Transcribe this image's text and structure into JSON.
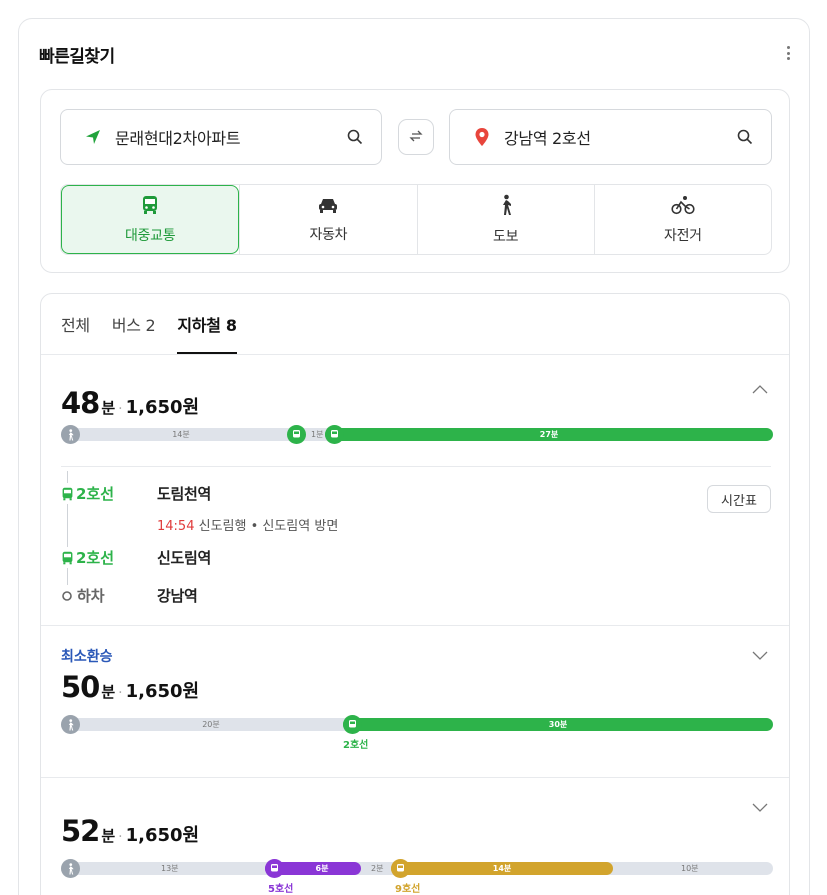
{
  "header": {
    "title": "빠른길찾기"
  },
  "search": {
    "from": "문래현대2차아파트",
    "to": "강남역 2호선"
  },
  "modes": [
    {
      "label": "대중교통",
      "icon": "bus-icon",
      "active": true
    },
    {
      "label": "자동차",
      "icon": "car-icon",
      "active": false
    },
    {
      "label": "도보",
      "icon": "walk-icon",
      "active": false
    },
    {
      "label": "자전거",
      "icon": "bicycle-icon",
      "active": false
    }
  ],
  "tabs": [
    {
      "label": "전체",
      "active": false
    },
    {
      "label": "버스 2",
      "active": false
    },
    {
      "label": "지하철 8",
      "active": true
    }
  ],
  "colors": {
    "line2": "#2db34a",
    "line5": "#8a36d6",
    "line9": "#d2a42d",
    "walk": "#dfe3ea",
    "tag": "#2a58b8",
    "time_red": "#e03c3c"
  },
  "routes": [
    {
      "time": "48",
      "unit": "분",
      "fare": "1,650원",
      "bar": {
        "walk1": "14분",
        "transfer_walk": "1분",
        "ride": "27분"
      },
      "detail": {
        "board_line": "2호선",
        "board_station": "도림천역",
        "depart_time": "14:54",
        "direction": "신도림행 • 신도림역 방면",
        "timetable": "시간표",
        "transfer_line": "2호선",
        "transfer_station": "신도림역",
        "alight_label": "하차",
        "alight_station": "강남역"
      }
    },
    {
      "tag": "최소환승",
      "time": "50",
      "unit": "분",
      "fare": "1,650원",
      "bar": {
        "walk1": "20분",
        "ride": "30분",
        "line_label": "2호선"
      }
    },
    {
      "time": "52",
      "unit": "분",
      "fare": "1,650원",
      "bar": {
        "walk1": "13분",
        "ride1": "6분",
        "walk2": "2분",
        "ride2": "14분",
        "walk3": "10분",
        "line1_label": "5호선",
        "line2_label": "9호선"
      }
    }
  ]
}
